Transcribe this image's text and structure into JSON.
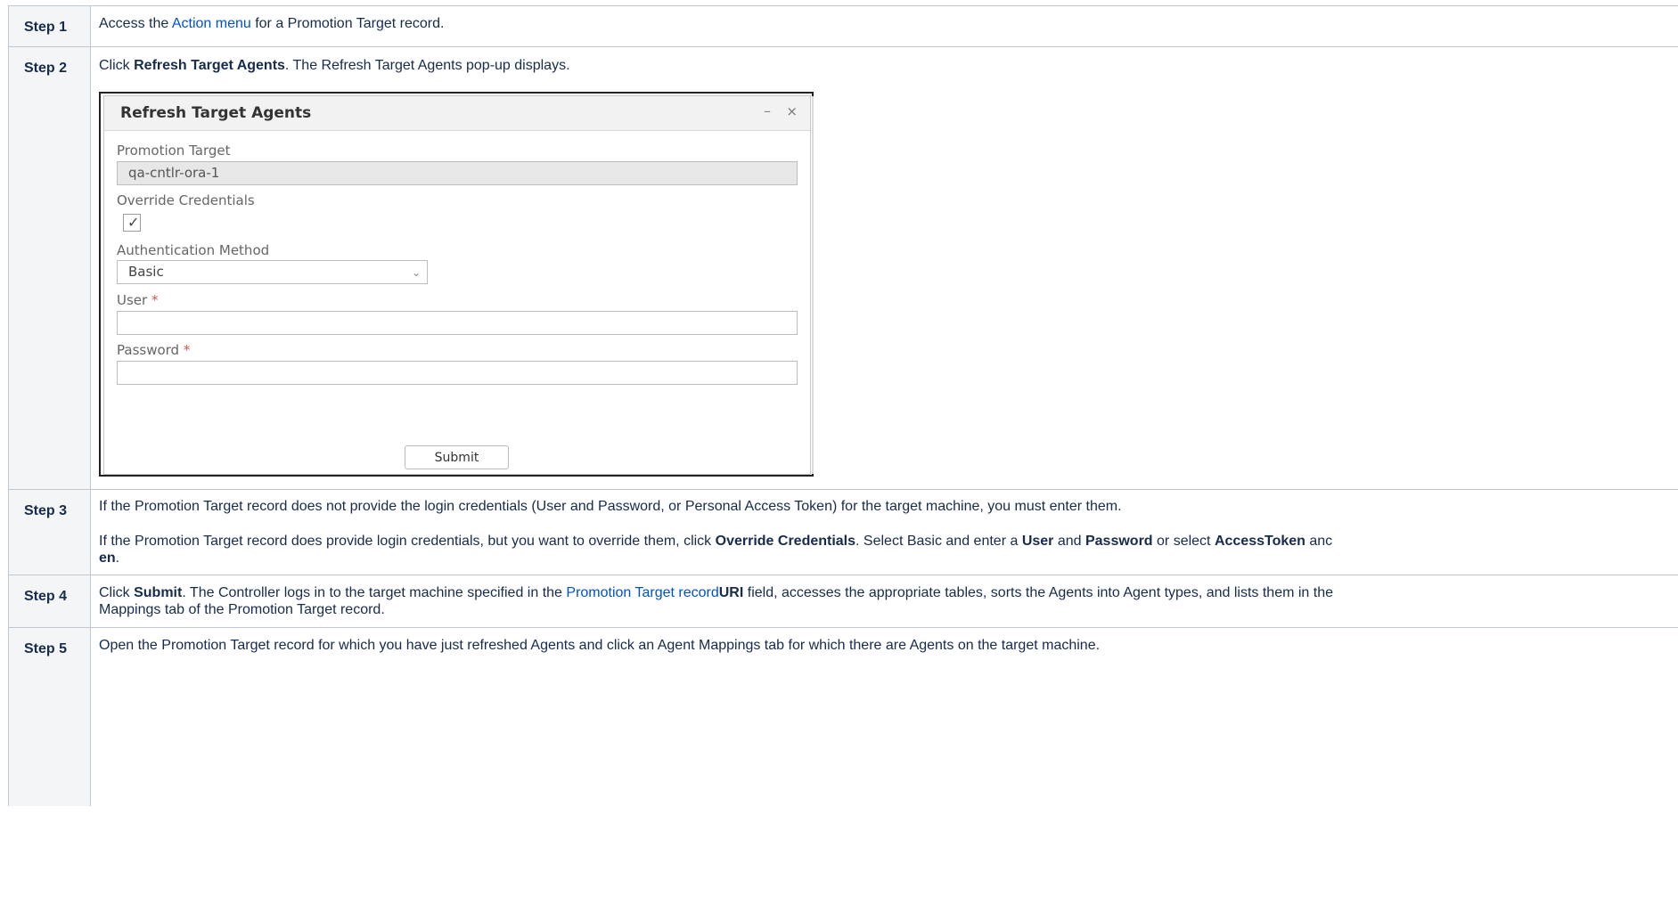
{
  "steps": [
    {
      "label": "Step 1"
    },
    {
      "label": "Step 2"
    },
    {
      "label": "Step 3"
    },
    {
      "label": "Step 4"
    },
    {
      "label": "Step 5"
    }
  ],
  "step1": {
    "text_before": "Access the ",
    "link": "Action menu",
    "text_after": " for a Promotion Target record."
  },
  "step2": {
    "text_before": "Click ",
    "bold": "Refresh Target Agents",
    "text_after": ". The Refresh Target Agents pop-up displays."
  },
  "dialog": {
    "title": "Refresh Target Agents",
    "minimize_glyph": "–",
    "close_glyph": "×",
    "promotion_target_label": "Promotion Target",
    "promotion_target_value": "qa-cntlr-ora-1",
    "override_label": "Override Credentials",
    "override_checked": true,
    "auth_label": "Authentication Method",
    "auth_value": "Basic",
    "user_label": "User",
    "password_label": "Password",
    "required_mark": "*",
    "submit_label": "Submit"
  },
  "step3": {
    "para1": "If the Promotion Target record does not provide the login credentials (User and Password, or Personal Access Token) for the target machine, you must enter them.",
    "p2_a": "If the Promotion Target record does provide login credentials, but you want to override them, click ",
    "p2_b": "Override Credentials",
    "p2_c": ". Select Basic and enter a ",
    "p2_d": "User",
    "p2_e": " and ",
    "p2_f": "Password",
    "p2_g": " or select ",
    "p2_h": "AccessToken",
    "p2_i": " anc",
    "p2_j": "en",
    "p2_k": "."
  },
  "step4": {
    "a": "Click ",
    "b": "Submit",
    "c": ". The Controller logs in to the target machine specified in the ",
    "link": "Promotion Target record",
    "d": "URI",
    "e": " field, accesses the appropriate tables, sorts the Agents into Agent types, and lists them in the",
    "line2": "Mappings tab of the Promotion Target record."
  },
  "step5": {
    "text": "Open the Promotion Target record for which you have just refreshed Agents and click an Agent Mappings tab for which there are Agents on the target machine."
  }
}
